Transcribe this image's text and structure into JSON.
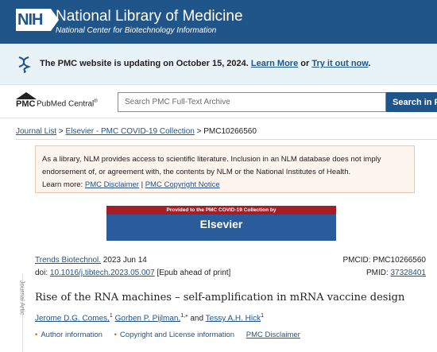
{
  "header": {
    "logo_text": "NIH",
    "title": "National Library of Medicine",
    "subtitle": "National Center for Biotechnology Information"
  },
  "banner": {
    "message": "The PMC website is updating on October 15, 2024.",
    "learn_more": "Learn More",
    "or_text": "or",
    "try_it": "Try it out now",
    "period": "."
  },
  "pmc": {
    "logo_short": "PMC",
    "logo_long": "PubMed Central",
    "logo_mark": "®",
    "search_placeholder": "Search PMC Full-Text Archive",
    "search_button": "Search in PMC"
  },
  "breadcrumb": {
    "journal_list": "Journal List",
    "sep1": ">",
    "collection": "Elsevier - PMC COVID-19 Collection",
    "sep2": ">",
    "current": "PMC10266560"
  },
  "disclaimer": {
    "line1": "As a library, NLM provides access to scientific literature. Inclusion in an NLM database does not imply",
    "line2": "endorsement of, or agreement with, the contents by NLM or the National Institutes of Health.",
    "learn_more": "Learn more:",
    "pmc_disclaimer": "PMC Disclaimer",
    "pipe": "|",
    "copyright_notice": "PMC Copyright Notice"
  },
  "collection_banner": {
    "provided_text": "Provided to the PMC COVID-19 Collection by",
    "publisher": "Elsevier"
  },
  "sidebar": {
    "label": "Journal Artic"
  },
  "article": {
    "journal": "Trends Biotechnol.",
    "date": "2023 Jun 14",
    "doi_label": "doi:",
    "doi": "10.1016/j.tibtech.2023.05.007",
    "epub": "[Epub ahead of print]",
    "pmcid_label": "PMCID:",
    "pmcid": "PMC10266560",
    "pmid_label": "PMID:",
    "pmid": "37328401",
    "title": "Rise of the RNA machines – self-amplification in mRNA vaccine design",
    "authors": [
      {
        "name": "Jerome D.G. Comes,",
        "sup": "1"
      },
      {
        "name": "Gorben P. Pijlman,",
        "sup": "1,⁎"
      },
      {
        "name": "Tessy A.H. Hick",
        "sup": "1"
      }
    ],
    "and_text": "and",
    "links": {
      "author_info": "Author information",
      "copyright": "Copyright and License information",
      "disclaimer": "PMC Disclaimer"
    }
  },
  "colors": {
    "nih_blue": "#20558a",
    "banner_bg": "#e8f3f8",
    "disclaimer_bg": "#fef5ee",
    "elsevier_red": "#a31f25",
    "elsevier_blue": "#2a5c9b"
  }
}
